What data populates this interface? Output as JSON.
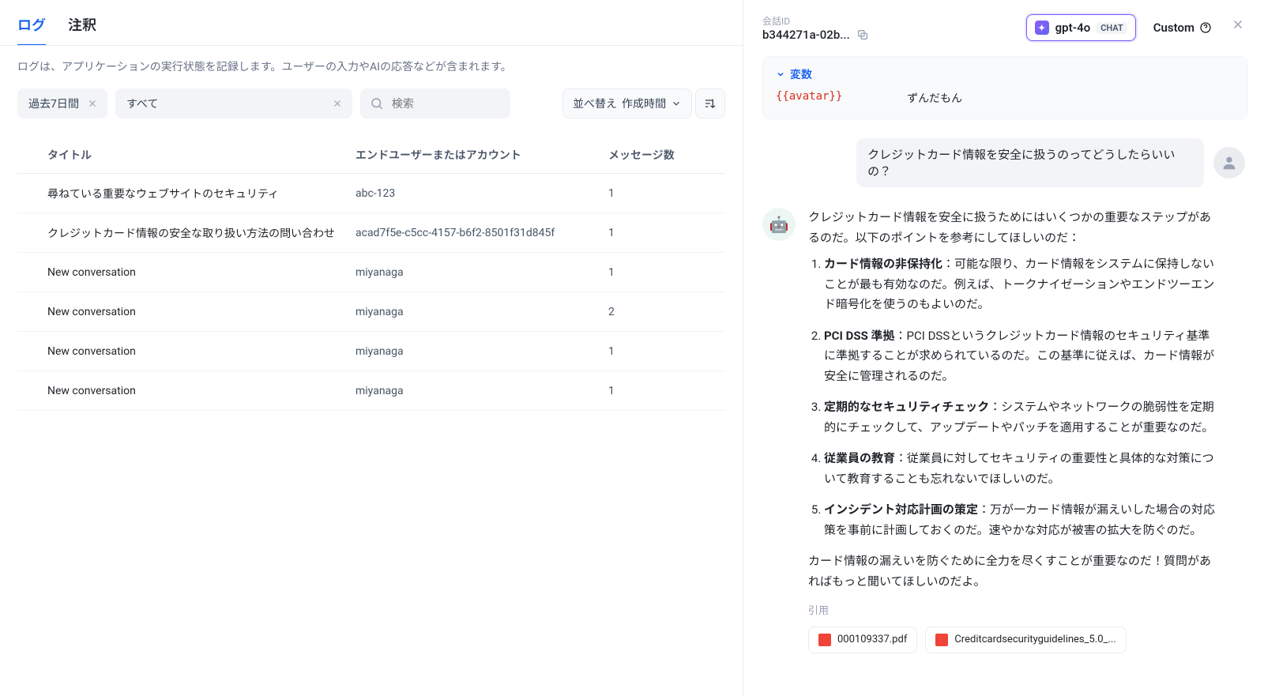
{
  "tabs": {
    "logs": "ログ",
    "annotations": "注釈"
  },
  "subtitle": "ログは、アプリケーションの実行状態を記録します。ユーザーの入力やAIの応答などが含まれます。",
  "filters": {
    "range": "過去7日間",
    "scope": "すべて",
    "search_placeholder": "検索"
  },
  "sort": {
    "prefix": "並べ替え",
    "field": "作成時間"
  },
  "columns": {
    "title": "タイトル",
    "user": "エンドユーザーまたはアカウント",
    "count": "メッセージ数"
  },
  "rows": [
    {
      "unread": false,
      "title": "尋ねている重要なウェブサイトのセキュリティ",
      "user": "abc-123",
      "count": "1"
    },
    {
      "unread": false,
      "title": "クレジットカード情報の安全な取り扱い方法の問い合わせ",
      "user": "acad7f5e-c5cc-4157-b6f2-8501f31d845f",
      "count": "1"
    },
    {
      "unread": false,
      "title": "New conversation",
      "user": "miyanaga",
      "count": "1"
    },
    {
      "unread": true,
      "title": "New conversation",
      "user": "miyanaga",
      "count": "2"
    },
    {
      "unread": true,
      "title": "New conversation",
      "user": "miyanaga",
      "count": "1"
    },
    {
      "unread": true,
      "title": "New conversation",
      "user": "miyanaga",
      "count": "1"
    }
  ],
  "detail": {
    "conv_label": "会話ID",
    "conv_id": "b344271a-02b...",
    "model": "gpt-4o",
    "model_badge": "CHAT",
    "custom_label": "Custom",
    "variables": {
      "header": "変数",
      "key": "{{avatar}}",
      "value": "ずんだもん"
    },
    "user_message": "クレジットカード情報を安全に扱うのってどうしたらいいの？",
    "ai_emoji": "🤖",
    "ai_intro": "クレジットカード情報を安全に扱うためにはいくつかの重要なステップがあるのだ。以下のポイントを参考にしてほしいのだ：",
    "ai_points": [
      {
        "title": "カード情報の非保持化",
        "body": "：可能な限り、カード情報をシステムに保持しないことが最も有効なのだ。例えば、トークナイゼーションやエンドツーエンド暗号化を使うのもよいのだ。"
      },
      {
        "title": "PCI DSS 準拠",
        "body": "：PCI DSSというクレジットカード情報のセキュリティ基準に準拠することが求められているのだ。この基準に従えば、カード情報が安全に管理されるのだ。"
      },
      {
        "title": "定期的なセキュリティチェック",
        "body": "：システムやネットワークの脆弱性を定期的にチェックして、アップデートやパッチを適用することが重要なのだ。"
      },
      {
        "title": "従業員の教育",
        "body": "：従業員に対してセキュリティの重要性と具体的な対策について教育することも忘れないでほしいのだ。"
      },
      {
        "title": "インシデント対応計画の策定",
        "body": "：万が一カード情報が漏えいした場合の対応策を事前に計画しておくのだ。速やかな対応が被害の拡大を防ぐのだ。"
      }
    ],
    "ai_outro": "カード情報の漏えいを防ぐために全力を尽くすことが重要なのだ！質問があればもっと聞いてほしいのだよ。",
    "cite_label": "引用",
    "cites": [
      "000109337.pdf",
      "Creditcardsecurityguidelines_5.0_..."
    ]
  }
}
